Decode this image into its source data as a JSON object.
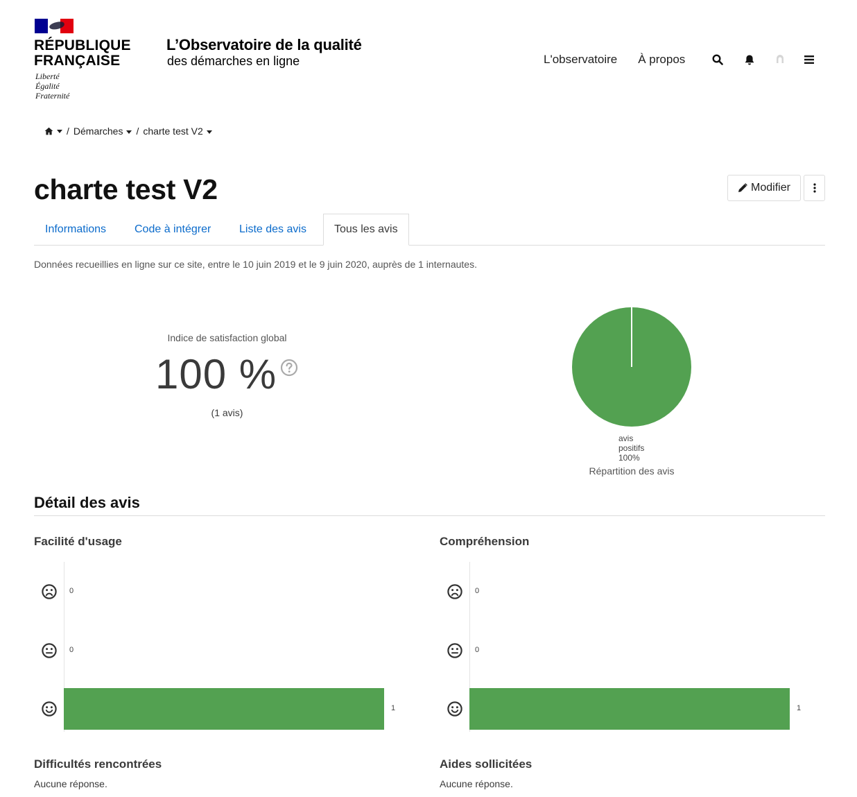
{
  "header": {
    "republic_line1": "RÉPUBLIQUE",
    "republic_line2": "FRANÇAISE",
    "motto_1": "Liberté",
    "motto_2": "Égalité",
    "motto_3": "Fraternité",
    "site_title": "L’Observatoire de la qualité",
    "site_tagline": "des démarches en ligne",
    "nav": {
      "observatoire": "L'observatoire",
      "apropos": "À propos"
    },
    "icons": [
      "search-icon",
      "bell-icon",
      "user-icon",
      "menu-icon"
    ]
  },
  "breadcrumb": {
    "home_icon": "home-icon",
    "sep": "/",
    "item1": "Démarches",
    "item2": "charte test V2"
  },
  "page": {
    "title": "charte test V2",
    "modify_label": "Modifier"
  },
  "tabs": [
    {
      "label": "Informations",
      "active": false
    },
    {
      "label": "Code à intégrer",
      "active": false
    },
    {
      "label": "Liste des avis",
      "active": false
    },
    {
      "label": "Tous les avis",
      "active": true
    }
  ],
  "collect_info": "Données recueillies en ligne sur ce site, entre le 10 juin 2019 et le 9 juin 2020, auprès de 1 internautes.",
  "satisfaction": {
    "label": "Indice de satisfaction global",
    "value": "100 %",
    "count": "(1 avis)"
  },
  "chart_data": [
    {
      "type": "pie",
      "title": "Répartition des avis",
      "slices": [
        {
          "label_line1": "avis",
          "label_line2": "positifs",
          "value_label": "100%",
          "value": 100,
          "color": "#53a151"
        }
      ]
    },
    {
      "type": "bar",
      "title": "Facilité d'usage",
      "categories": [
        "frown-icon",
        "meh-icon",
        "smile-icon"
      ],
      "values": [
        0,
        0,
        1
      ],
      "xlim": [
        0,
        1
      ],
      "color": "#53a151"
    },
    {
      "type": "bar",
      "title": "Compréhension",
      "categories": [
        "frown-icon",
        "meh-icon",
        "smile-icon"
      ],
      "values": [
        0,
        0,
        1
      ],
      "xlim": [
        0,
        1
      ],
      "color": "#53a151"
    }
  ],
  "detail": {
    "section_title": "Détail des avis",
    "difficultes_title": "Difficultés rencontrées",
    "difficultes_text": "Aucune réponse.",
    "aides_title": "Aides sollicitées",
    "aides_text": "Aucune réponse."
  },
  "colors": {
    "link": "#0b6bcb",
    "positive": "#53a151",
    "flag_blue": "#000091",
    "flag_red": "#e1000f"
  }
}
